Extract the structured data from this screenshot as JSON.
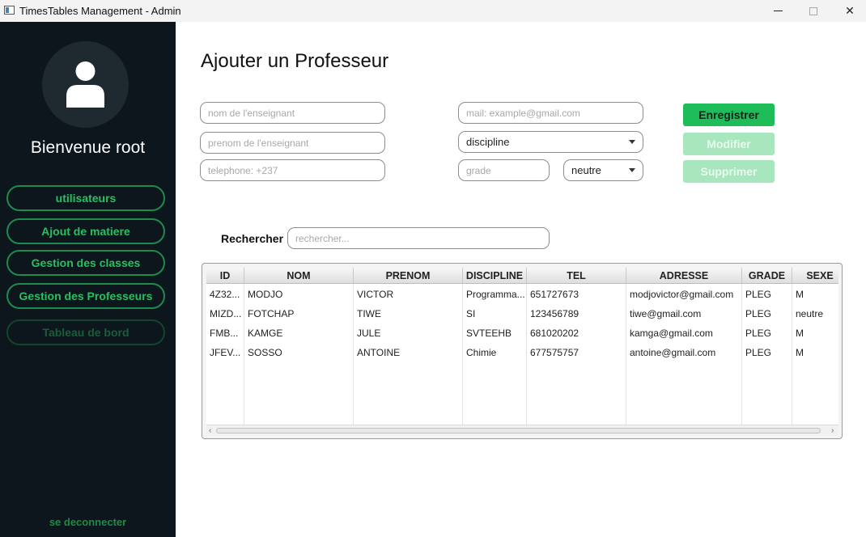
{
  "window": {
    "title": "TimesTables Management - Admin",
    "minimize_icon": "minimize-icon",
    "maximize_icon": "maximize-icon",
    "close_symbol": "✕"
  },
  "sidebar": {
    "welcome": "Bienvenue root",
    "avatar_icon": "user-icon",
    "items": [
      {
        "label": "utilisateurs",
        "enabled": true
      },
      {
        "label": "Ajout de matiere",
        "enabled": true
      },
      {
        "label": "Gestion des classes",
        "enabled": true
      },
      {
        "label": "Gestion des Professeurs",
        "enabled": true
      },
      {
        "label": "Tableau de bord",
        "enabled": false
      }
    ],
    "logout": "se deconnecter",
    "colors": {
      "background": "#0c161c",
      "accent": "#27c060"
    }
  },
  "form": {
    "title": "Ajouter un Professeur",
    "nom_placeholder": "nom de l'enseignant",
    "prenom_placeholder": "prenom de l'enseignant",
    "telephone_placeholder": "telephone: +237",
    "mail_placeholder": "mail: example@gmail.com",
    "discipline_value": "discipline",
    "grade_placeholder": "grade",
    "sexe_value": "neutre",
    "save_label": "Enregistrer",
    "modify_label": "Modifier",
    "delete_label": "Supprimer"
  },
  "search": {
    "label": "Rechercher :",
    "placeholder": "rechercher..."
  },
  "table": {
    "columns": [
      "ID",
      "NOM",
      "PRENOM",
      "DISCIPLINE",
      "TEL",
      "ADRESSE",
      "GRADE",
      "SEXE"
    ],
    "rows": [
      [
        "4Z32...",
        "MODJO",
        "VICTOR",
        "Programma...",
        "651727673",
        "modjovictor@gmail.com",
        "PLEG",
        "M"
      ],
      [
        "MIZD...",
        "FOTCHAP",
        "TIWE",
        "SI",
        "123456789",
        "tiwe@gmail.com",
        "PLEG",
        "neutre"
      ],
      [
        "FMB...",
        "KAMGE",
        "JULE",
        "SVTEEHB",
        "681020202",
        "kamga@gmail.com",
        "PLEG",
        "M"
      ],
      [
        "JFEV...",
        "SOSSO",
        "ANTOINE",
        "Chimie",
        "677575757",
        "antoine@gmail.com",
        "PLEG",
        "M"
      ]
    ],
    "scroll_left": "‹",
    "scroll_right": "›"
  }
}
